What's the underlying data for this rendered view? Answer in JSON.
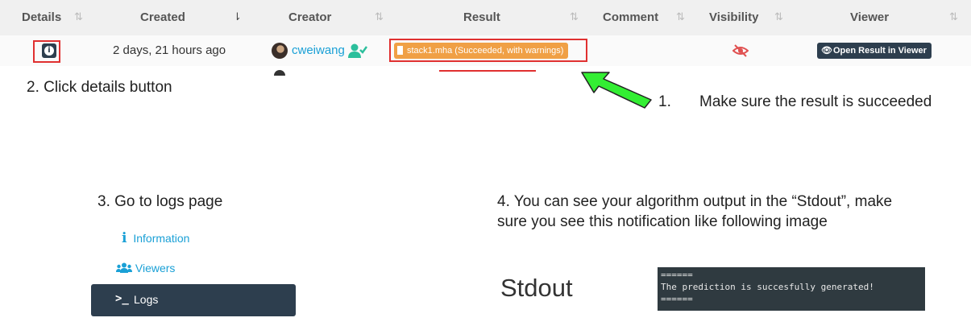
{
  "table": {
    "columns": [
      "Details",
      "Created",
      "Creator",
      "Result",
      "Comment",
      "Visibility",
      "Viewer"
    ],
    "row": {
      "created": "2 days, 21 hours ago",
      "creator": "cweiwang",
      "result": "stack1.mha (Succeeded, with warnings)",
      "viewer_button": "Open Result in Viewer"
    }
  },
  "annotations": {
    "step1_num": "1.",
    "step1": "Make sure the result is succeeded",
    "step2": "2. Click details button",
    "step3": "3. Go to logs page",
    "step4_line1": "4. You can see your algorithm output in the “Stdout”, make",
    "step4_line2": "sure you see this notification like following image"
  },
  "menu": {
    "information": "Information",
    "viewers": "Viewers",
    "logs": "Logs"
  },
  "stdout": {
    "title": "Stdout",
    "lines": [
      "======",
      "The prediction is succesfully generated!",
      "======"
    ]
  },
  "colors": {
    "accent": "#1aa0d6",
    "dark": "#2d3e4e",
    "warning": "#f0a045",
    "highlight": "#e03030",
    "arrow": "#33ee33"
  }
}
